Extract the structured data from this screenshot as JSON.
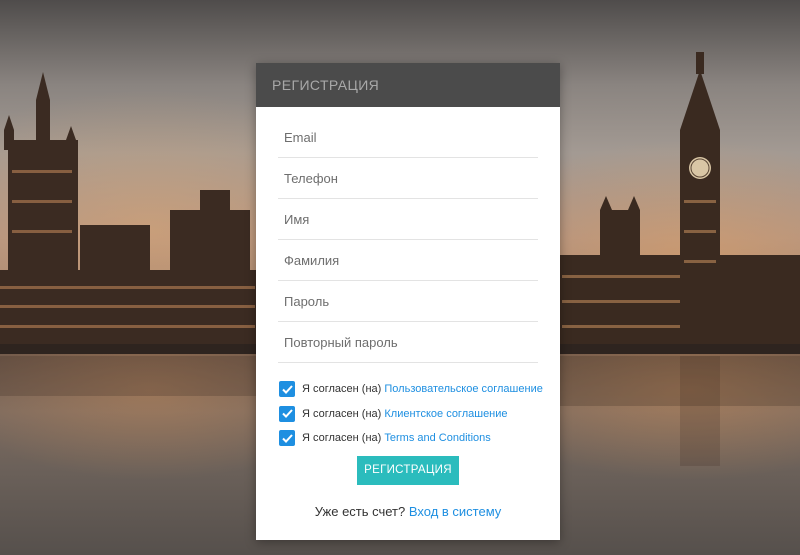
{
  "form": {
    "title": "РЕГИСТРАЦИЯ",
    "fields": [
      {
        "placeholder": "Email"
      },
      {
        "placeholder": "Телефон"
      },
      {
        "placeholder": "Имя"
      },
      {
        "placeholder": "Фамилия"
      },
      {
        "placeholder": "Пароль"
      },
      {
        "placeholder": "Повторный пароль"
      }
    ],
    "agreements": [
      {
        "prefix": "Я согласен (на)",
        "link": "Пользовательское соглашение",
        "checked": true
      },
      {
        "prefix": "Я согласен (на)",
        "link": "Клиентское соглашение",
        "checked": true
      },
      {
        "prefix": "Я согласен (на)",
        "link": "Terms and Conditions",
        "checked": true
      }
    ],
    "submit_label": "РЕГИСТРАЦИЯ",
    "login_prompt": "Уже есть счет?",
    "login_link": "Вход в систему"
  },
  "colors": {
    "header_bg": "#4b4b4b",
    "accent_link": "#1e8fe1",
    "button_bg": "#2bbcbd"
  },
  "icons": {
    "checkbox": "check-icon"
  }
}
